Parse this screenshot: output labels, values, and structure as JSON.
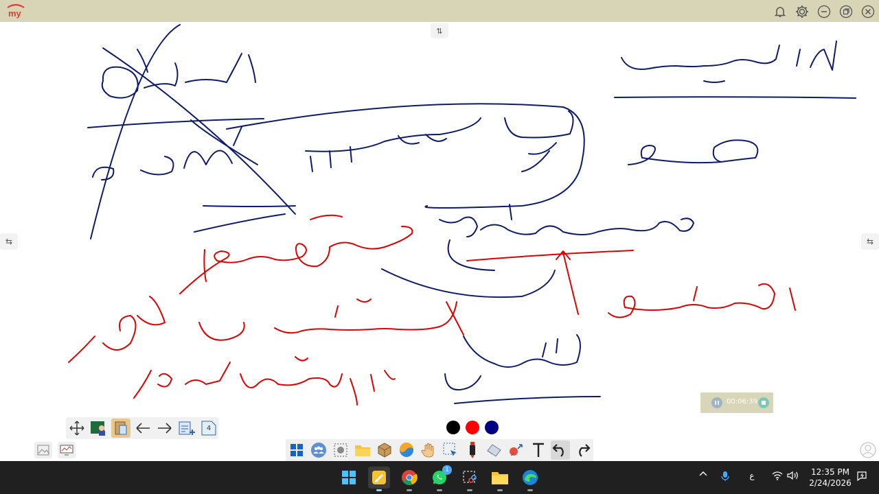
{
  "app": {
    "logo_text": "my",
    "accent": "#e53935"
  },
  "titlebar": {
    "color": "#d8d4b6"
  },
  "whiteboard": {
    "pen_colors": [
      "#000000",
      "#ff0000",
      "#000080"
    ],
    "page_count": "4"
  },
  "recorder": {
    "elapsed": "00:06:39"
  },
  "toolbar": {
    "icons": [
      "windows-icon",
      "people-icon",
      "screenshot-icon",
      "folder-icon",
      "box-icon",
      "browser-icon",
      "hand-icon",
      "select-icon",
      "marker-icon",
      "eraser-icon",
      "shapes-icon",
      "text-icon",
      "undo-icon",
      "redo-icon"
    ]
  },
  "taskbar": {
    "whatsapp_badge": "1",
    "input_language": "ع",
    "time": "12:35 PM",
    "date": "2/24/2026"
  }
}
